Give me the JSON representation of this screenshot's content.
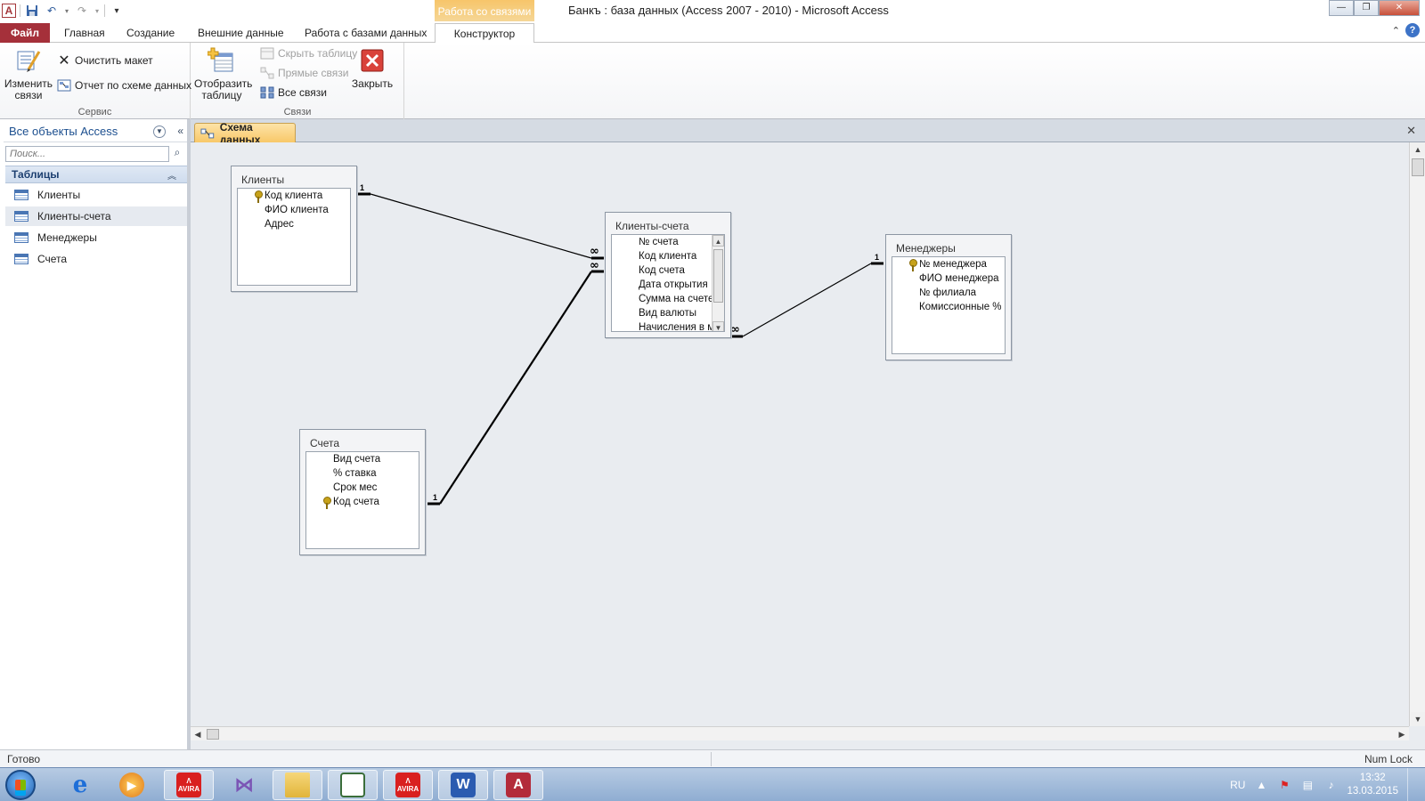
{
  "app": {
    "window_title": "Банкъ : база данных (Access 2007 - 2010)  -  Microsoft Access",
    "contextual_tab_title": "Работа со связями",
    "colors": {
      "file_tab": "#a5303a",
      "contextual": "#f7c56a",
      "accent": "#1c4f8f"
    }
  },
  "tabs": [
    "Файл",
    "Главная",
    "Создание",
    "Внешние данные",
    "Работа с базами данных",
    "Конструктор"
  ],
  "ribbon": {
    "tools_group": {
      "label": "Сервис",
      "edit_relationships": "Изменить\nсвязи",
      "clear_layout": "Очистить макет",
      "relationship_report": "Отчет по схеме данных"
    },
    "relationships_group": {
      "label": "Связи",
      "show_table": "Отобразить\nтаблицу",
      "hide_table": "Скрыть таблицу",
      "direct_relationships": "Прямые связи",
      "all_relationships": "Все связи"
    },
    "close": "Закрыть"
  },
  "nav": {
    "title": "Все объекты Access",
    "search_placeholder": "Поиск...",
    "group_label": "Таблицы",
    "items": [
      "Клиенты",
      "Клиенты-счета",
      "Менеджеры",
      "Счета"
    ],
    "selected": "Клиенты-счета"
  },
  "document": {
    "tab_label": "Схема данных"
  },
  "tables": [
    {
      "id": "clients",
      "title": "Клиенты",
      "fields": [
        {
          "name": "Код клиента",
          "key": true
        },
        {
          "name": "ФИО клиента",
          "key": false
        },
        {
          "name": "Адрес",
          "key": false
        }
      ]
    },
    {
      "id": "clients_accounts",
      "title": "Клиенты-счета",
      "fields": [
        {
          "name": "№ счета",
          "key": false
        },
        {
          "name": "Код клиента",
          "key": false
        },
        {
          "name": "Код счета",
          "key": false
        },
        {
          "name": "Дата открытия",
          "key": false
        },
        {
          "name": "Сумма на счете",
          "key": false
        },
        {
          "name": "Вид валюты",
          "key": false
        },
        {
          "name": "Начисления в м",
          "key": false
        }
      ]
    },
    {
      "id": "managers",
      "title": "Менеджеры",
      "fields": [
        {
          "name": "№ менеджера",
          "key": true
        },
        {
          "name": "ФИО менеджера",
          "key": false
        },
        {
          "name": "№ филиала",
          "key": false
        },
        {
          "name": "Комиссионные %",
          "key": false
        }
      ]
    },
    {
      "id": "accounts",
      "title": "Счета",
      "fields": [
        {
          "name": "Вид счета",
          "key": false
        },
        {
          "name": "% ставка",
          "key": false
        },
        {
          "name": "Срок мес",
          "key": false
        },
        {
          "name": "Код счета",
          "key": true
        }
      ]
    }
  ],
  "relationships": [
    {
      "from": "clients",
      "to": "clients_accounts",
      "one_label": "1",
      "many_label": "∞"
    },
    {
      "from": "accounts",
      "to": "clients_accounts",
      "one_label": "1",
      "many_label": "∞"
    },
    {
      "from": "managers",
      "to": "clients_accounts",
      "one_label": "1",
      "many_label": "∞"
    }
  ],
  "status": {
    "left": "Готово",
    "right": "Num Lock"
  },
  "taskbar": {
    "apps": [
      "Internet Explorer",
      "Media Player",
      "AVIRA",
      "Visual Studio",
      "Проводник",
      "Презентация",
      "AVIRA",
      "Word",
      "Access"
    ],
    "lang": "RU",
    "time": "13:32",
    "date": "13.03.2015"
  }
}
